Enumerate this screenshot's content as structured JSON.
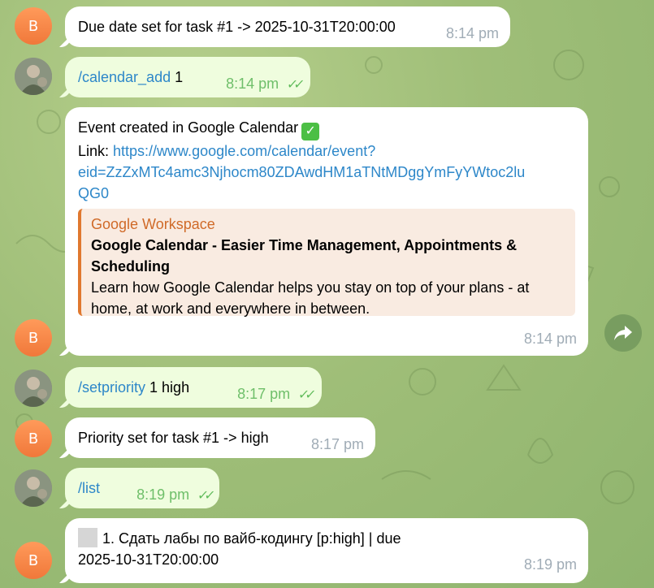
{
  "messages": {
    "m1": {
      "text": "Due date set for task #1 -> 2025-10-31T20:00:00",
      "time": "8:14 pm",
      "avatar": "B"
    },
    "m2": {
      "command": "/calendar_add",
      "arg": " 1",
      "time": "8:14 pm"
    },
    "m3": {
      "line1": "Event created in Google Calendar",
      "link_label": "Link: ",
      "link_url_line1": "https://www.google.com/calendar/event?",
      "link_url_line2": "eid=ZzZxMTc4amc3Njhocm80ZDAwdHM1aTNtMDggYmFyYWtoc2lu",
      "link_url_line3": "QG0",
      "preview_site": "Google Workspace",
      "preview_title": "Google Calendar - Easier Time Management, Appointments & Scheduling",
      "preview_desc": "Learn how Google Calendar helps you stay on top of your plans - at home, at work and everywhere in between.",
      "time": "8:14 pm",
      "avatar": "B",
      "emoji": "✓"
    },
    "m4": {
      "command": "/setpriority",
      "arg": " 1 high",
      "time": "8:17 pm"
    },
    "m5": {
      "text": "Priority set for task #1 -> high",
      "time": "8:17 pm",
      "avatar": "B"
    },
    "m6": {
      "command": "/list",
      "time": "8:19 pm"
    },
    "m7": {
      "line1": "1. Сдать лабы по вайб-кодингу [p:high] | due",
      "line2": "2025-10-31T20:00:00",
      "time": "8:19 pm",
      "avatar": "B"
    }
  },
  "icons": {
    "forward": "share-forward-icon",
    "read_receipt": "double-check-icon"
  },
  "colors": {
    "incoming_bubble": "#ffffff",
    "outgoing_bubble": "#effdde",
    "link": "#2d87c9",
    "bot_avatar": "#f0783a",
    "preview_accent": "#e0782f"
  }
}
